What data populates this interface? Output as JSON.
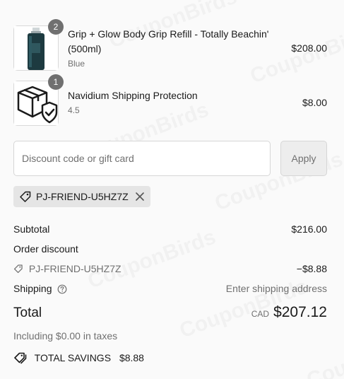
{
  "items": [
    {
      "quantity": "2",
      "name": "Grip + Glow Body Grip Refill - Totally Beachin' (500ml)",
      "variant": "Blue",
      "price": "$208.00",
      "image": "dark-bottle-product-image"
    },
    {
      "quantity": "1",
      "name": "Navidium Shipping Protection",
      "variant": "4.5",
      "price": "$8.00",
      "image": "box-shield-icon"
    }
  ],
  "discount": {
    "placeholder": "Discount code or gift card",
    "apply_label": "Apply",
    "applied_code": "PJ-FRIEND-U5HZ7Z"
  },
  "summary": {
    "subtotal_label": "Subtotal",
    "subtotal_value": "$216.00",
    "order_discount_label": "Order discount",
    "discount_code": "PJ-FRIEND-U5HZ7Z",
    "discount_value": "−$8.88",
    "shipping_label": "Shipping",
    "shipping_value": "Enter shipping address",
    "total_label": "Total",
    "currency": "CAD",
    "total_value": "$207.12",
    "taxes_note": "Including $0.00 in taxes",
    "savings_label": "TOTAL SAVINGS",
    "savings_value": "$8.88"
  },
  "watermark_text": "CouponBirds"
}
